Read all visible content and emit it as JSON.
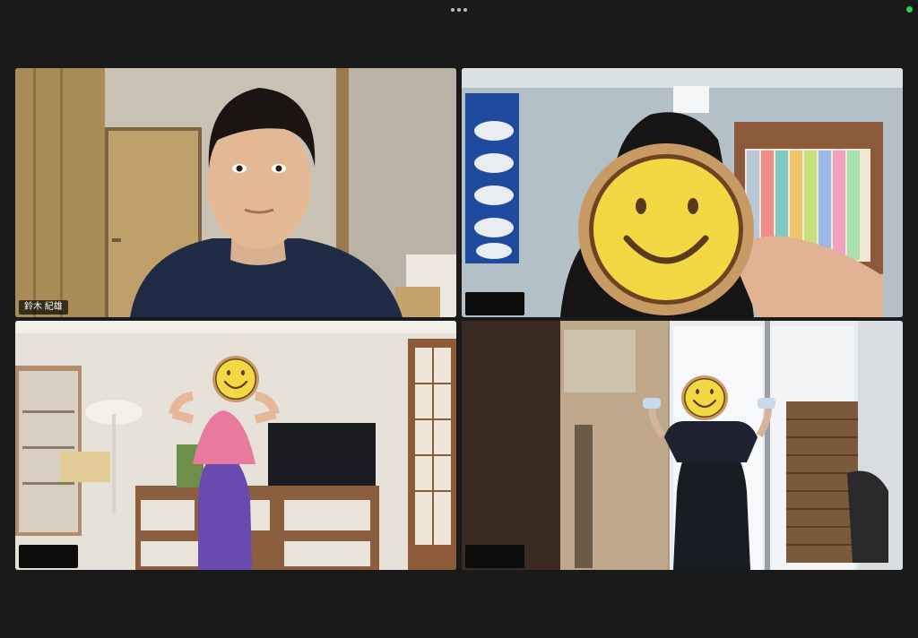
{
  "window": {
    "more_icon": "more-dots-icon",
    "status_color": "#2ed051"
  },
  "tiles": [
    {
      "name": "鈴木 紀雄",
      "speaking": false
    },
    {
      "name": "",
      "speaking": false
    },
    {
      "name": "",
      "speaking": false
    },
    {
      "name": "",
      "speaking": true
    }
  ],
  "colors": {
    "active_border": "#2ed051",
    "smiley_face": "#f3d843",
    "smiley_ring": "#6b4422"
  }
}
